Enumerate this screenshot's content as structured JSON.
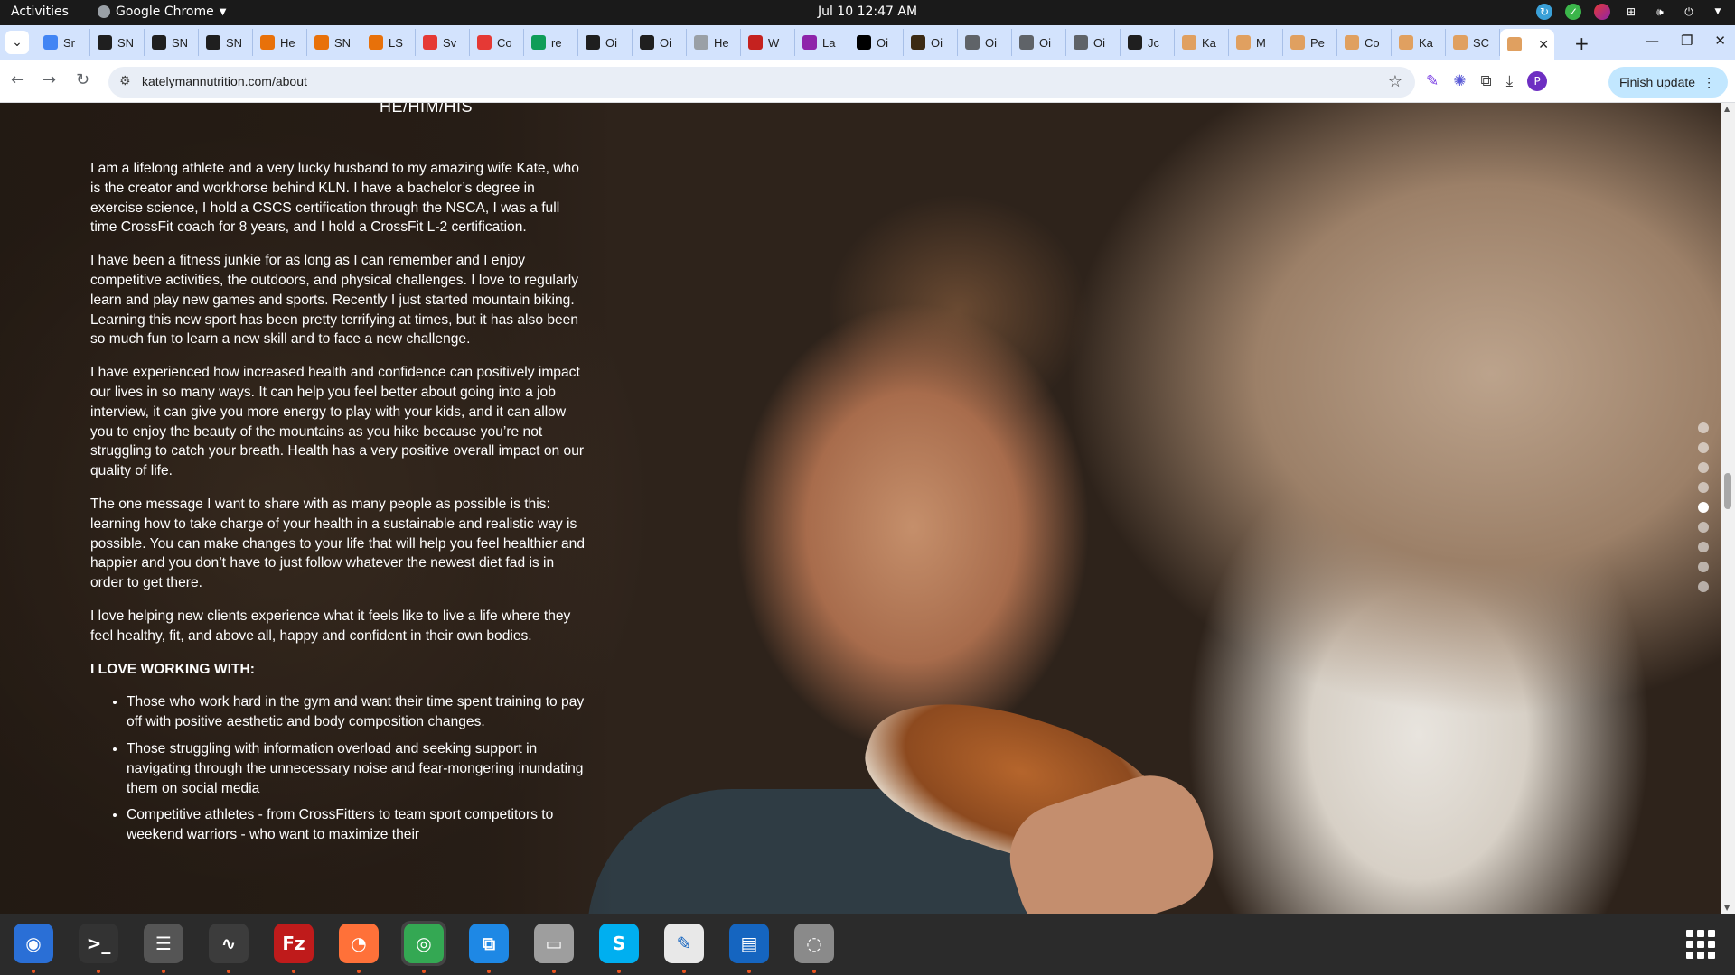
{
  "topbar": {
    "activities": "Activities",
    "app_name": "Google Chrome",
    "clock": "Jul 10  12:47 AM"
  },
  "tabs": [
    {
      "label": "Sr",
      "icon": "docs-icon",
      "color": "#4285f4"
    },
    {
      "label": "SN",
      "icon": "sn-icon",
      "color": "#1f1f1f"
    },
    {
      "label": "SN",
      "icon": "sn-icon",
      "color": "#1f1f1f"
    },
    {
      "label": "SN",
      "icon": "sn-icon",
      "color": "#1f1f1f"
    },
    {
      "label": "He",
      "icon": "swirl-icon",
      "color": "#e8710a"
    },
    {
      "label": "SN",
      "icon": "swirl-icon",
      "color": "#e8710a"
    },
    {
      "label": "LS",
      "icon": "swirl-icon",
      "color": "#e8710a"
    },
    {
      "label": "Sv",
      "icon": "fox-icon",
      "color": "#e53935"
    },
    {
      "label": "Co",
      "icon": "fox-icon",
      "color": "#e53935"
    },
    {
      "label": "re",
      "icon": "plus-square-icon",
      "color": "#0f9d58"
    },
    {
      "label": "Oi",
      "icon": "circle-icon",
      "color": "#1f1f1f"
    },
    {
      "label": "Oi",
      "icon": "arrow-icon",
      "color": "#1f1f1f"
    },
    {
      "label": "He",
      "icon": "page-icon",
      "color": "#9aa0a6"
    },
    {
      "label": "W",
      "icon": "bars-icon",
      "color": "#c5221f"
    },
    {
      "label": "La",
      "icon": "wave-icon",
      "color": "#8e24aa"
    },
    {
      "label": "Oi",
      "icon": "square-icon",
      "color": "#000000"
    },
    {
      "label": "Oi",
      "icon": "square-icon",
      "color": "#3b2a14"
    },
    {
      "label": "Oi",
      "icon": "bars-icon",
      "color": "#5f6368"
    },
    {
      "label": "Oi",
      "icon": "owl-icon",
      "color": "#5f6368"
    },
    {
      "label": "Oi",
      "icon": "globe-icon",
      "color": "#5f6368"
    },
    {
      "label": "Jc",
      "icon": "hook-icon",
      "color": "#1f1f1f"
    },
    {
      "label": "Ka",
      "icon": "cookie-icon",
      "color": "#e0a060"
    },
    {
      "label": "M",
      "icon": "cookie-icon",
      "color": "#e0a060"
    },
    {
      "label": "Pe",
      "icon": "cookie-icon",
      "color": "#e0a060"
    },
    {
      "label": "Co",
      "icon": "cookie-icon",
      "color": "#e0a060"
    },
    {
      "label": "Ka",
      "icon": "cookie-icon",
      "color": "#e0a060"
    },
    {
      "label": "SC",
      "icon": "cookie-icon",
      "color": "#e0a060"
    },
    {
      "label": "",
      "icon": "cookie-icon",
      "color": "#e0a060",
      "active": true
    }
  ],
  "toolbar": {
    "url": "katelymannutrition.com/about",
    "finish_update": "Finish update",
    "profile_initial": "P"
  },
  "page": {
    "pronouns": "HE/HIM/HIS",
    "paragraphs": [
      "I am a lifelong athlete and a very lucky husband to my amazing wife Kate, who is the creator and workhorse behind KLN. I have a bachelor’s degree in exercise science, I hold a CSCS certification through the NSCA, I was a full time CrossFit coach for 8 years, and I hold a CrossFit L-2 certification.",
      "I have been a fitness junkie for as long as I can remember and I enjoy competitive activities, the outdoors, and physical challenges. I love to regularly learn and play new games and sports. Recently I just started mountain biking. Learning this new sport has been pretty terrifying at times, but it has also been so much fun to learn a new skill and to face a new challenge.",
      "I have experienced how increased health and confidence can positively impact our lives in so many ways. It can help you feel better about going into a job interview, it can give you more energy to play with your kids, and it can allow you to enjoy the beauty of the mountains as you hike because you’re not struggling to catch your breath. Health has a very positive overall impact on our quality of life.",
      "The one message I want to share with as many people as possible is this: learning how to take charge of your health in a sustainable and realistic way is possible. You can make changes to your life that will help you feel healthier and happier and you don’t have to just follow whatever the newest diet fad is in order to get there.",
      "I love helping new clients experience what it feels like to live a life where they feel healthy, fit, and above all, happy and confident in their own bodies."
    ],
    "love_heading": "I LOVE WORKING WITH:",
    "love_items": [
      "Those who work hard in the gym and want their time spent training to pay off with positive aesthetic and body composition changes.",
      "Those struggling with information overload and seeking support in navigating through the unnecessary noise and fear-mongering inundating them on social media",
      "Competitive athletes - from CrossFitters to team sport competitors to weekend warriors - who want to maximize their"
    ],
    "section_dots_total": 9,
    "section_dots_active_index": 4
  },
  "dock": [
    {
      "name": "thunderbird",
      "color": "#2a6fd6",
      "glyph": "◉"
    },
    {
      "name": "terminal",
      "color": "#333333",
      "glyph": ">_"
    },
    {
      "name": "notes",
      "color": "#555555",
      "glyph": "☰"
    },
    {
      "name": "system-monitor",
      "color": "#3c3c3c",
      "glyph": "∿"
    },
    {
      "name": "filezilla",
      "color": "#bf1b1b",
      "glyph": "Fz"
    },
    {
      "name": "firefox",
      "color": "#ff7139",
      "glyph": "◔"
    },
    {
      "name": "chrome",
      "color": "#34a853",
      "glyph": "◎"
    },
    {
      "name": "vscode",
      "color": "#1e88e5",
      "glyph": "⧉"
    },
    {
      "name": "files",
      "color": "#9e9e9e",
      "glyph": "▭"
    },
    {
      "name": "skype",
      "color": "#00aff0",
      "glyph": "S"
    },
    {
      "name": "text-editor",
      "color": "#e8e8e8",
      "glyph": "✎"
    },
    {
      "name": "document-viewer",
      "color": "#1565c0",
      "glyph": "▤"
    },
    {
      "name": "disks",
      "color": "#8a8a8a",
      "glyph": "◌"
    }
  ]
}
